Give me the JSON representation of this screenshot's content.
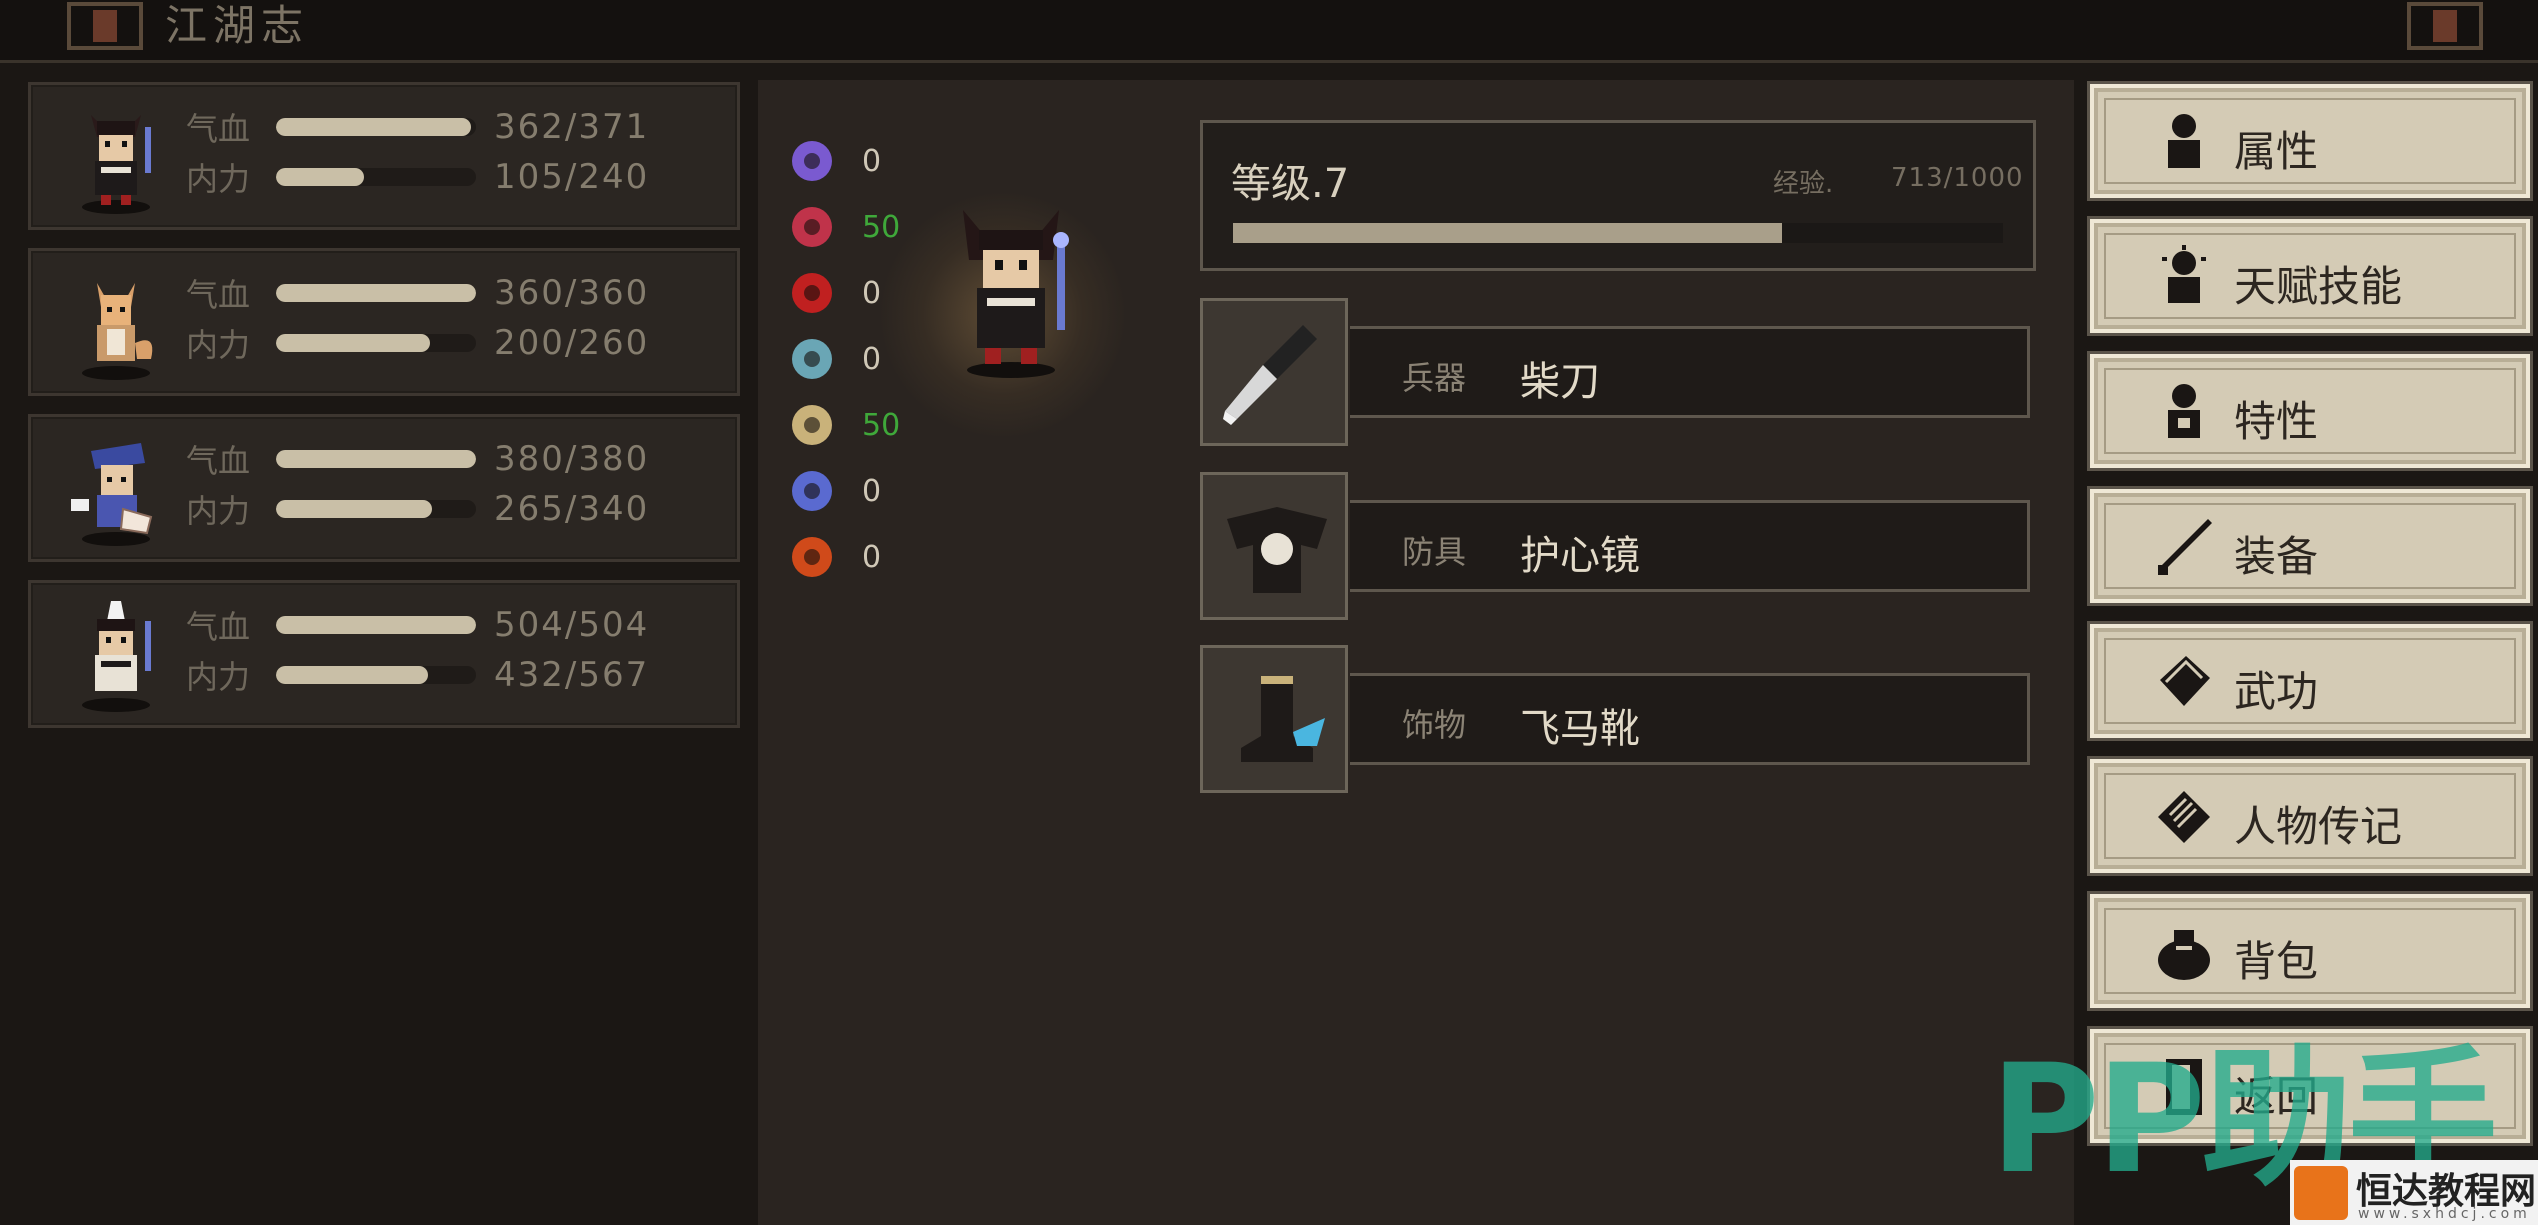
{
  "header": {
    "title": "江湖志"
  },
  "party": [
    {
      "hp_label": "气血",
      "hp_text": "362/371",
      "hp": 0.976,
      "mp_label": "内力",
      "mp_text": "105/240",
      "mp": 0.4375
    },
    {
      "hp_label": "气血",
      "hp_text": "360/360",
      "hp": 1.0,
      "mp_label": "内力",
      "mp_text": "200/260",
      "mp": 0.769
    },
    {
      "hp_label": "气血",
      "hp_text": "380/380",
      "hp": 1.0,
      "mp_label": "内力",
      "mp_text": "265/340",
      "mp": 0.779
    },
    {
      "hp_label": "气血",
      "hp_text": "504/504",
      "hp": 1.0,
      "mp_label": "内力",
      "mp_text": "432/567",
      "mp": 0.762
    }
  ],
  "resistances": [
    {
      "icon": "purple-skull-icon",
      "color": "#7a5ad0",
      "value": "0",
      "positive": false
    },
    {
      "icon": "broken-heart-icon",
      "color": "#c0334a",
      "value": "50",
      "positive": true
    },
    {
      "icon": "red-splat-icon",
      "color": "#c02020",
      "value": "0",
      "positive": false
    },
    {
      "icon": "teal-skull-icon",
      "color": "#6aa6b5",
      "value": "0",
      "positive": false
    },
    {
      "icon": "bone-icon",
      "color": "#c9b27a",
      "value": "50",
      "positive": true
    },
    {
      "icon": "blue-mask-icon",
      "color": "#5a6ad0",
      "value": "0",
      "positive": false
    },
    {
      "icon": "fire-icon",
      "color": "#d04a1a",
      "value": "0",
      "positive": false
    }
  ],
  "level": {
    "label": "等级.7",
    "exp_label": "经验.",
    "exp_text": "713/1000",
    "progress": 0.713
  },
  "equipment": [
    {
      "category": "兵器",
      "name": "柴刀",
      "icon": "cleaver-icon"
    },
    {
      "category": "防具",
      "name": "护心镜",
      "icon": "chest-mirror-icon"
    },
    {
      "category": "饰物",
      "name": "飞马靴",
      "icon": "boots-icon"
    }
  ],
  "menu": [
    {
      "label": "属性",
      "icon": "figure-icon"
    },
    {
      "label": "天赋技能",
      "icon": "talent-figure-icon"
    },
    {
      "label": "特性",
      "icon": "trait-figure-icon"
    },
    {
      "label": "装备",
      "icon": "sword-icon"
    },
    {
      "label": "武功",
      "icon": "book-icon"
    },
    {
      "label": "人物传记",
      "icon": "scroll-icon"
    },
    {
      "label": "背包",
      "icon": "bag-icon"
    },
    {
      "label": "返回",
      "icon": "door-icon"
    }
  ],
  "watermark": {
    "text": "PP助手",
    "badge_title": "恒达教程网",
    "badge_url": "www.sxhdcj.com"
  }
}
